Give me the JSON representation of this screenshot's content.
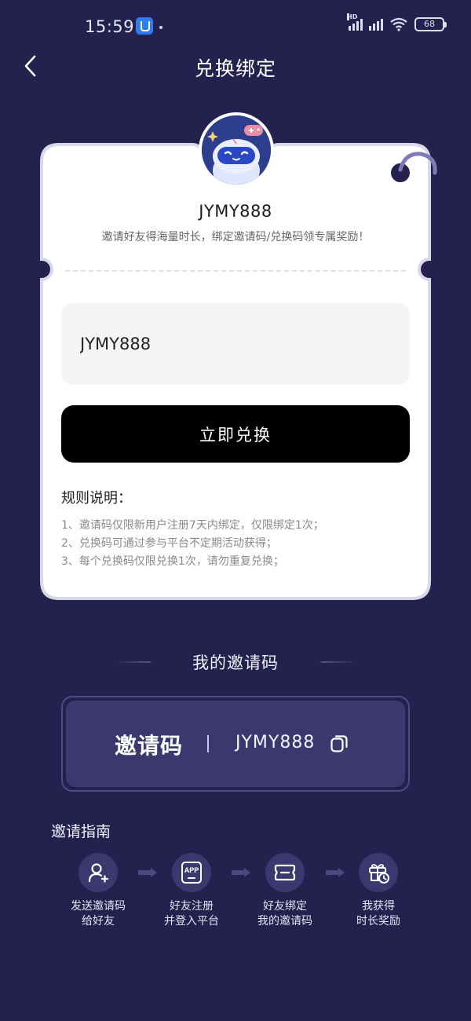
{
  "status_bar": {
    "time": "15:59",
    "battery": "68",
    "network_badge": "HD"
  },
  "header": {
    "title": "兑换绑定"
  },
  "card": {
    "username": "JYMY888",
    "subtitle": "邀请好友得海量时长，绑定邀请码/兑换码领专属奖励！",
    "code_input_value": "JYMY888",
    "redeem_button_label": "立即兑换",
    "rules_title": "规则说明：",
    "rules": [
      "1、邀请码仅限新用户注册7天内绑定，仅限绑定1次；",
      "2、兑换码可通过参与平台不定期活动获得；",
      "3、每个兑换码仅限兑换1次，请勿重复兑换；"
    ]
  },
  "my_invite": {
    "section_title": "我的邀请码",
    "label": "邀请码",
    "code": "JYMY888"
  },
  "guide": {
    "title": "邀请指南",
    "steps": [
      {
        "line1": "发送邀请码",
        "line2": "给好友",
        "icon": "user-add-icon"
      },
      {
        "line1": "好友注册",
        "line2": "并登入平台",
        "icon": "app-icon"
      },
      {
        "line1": "好友绑定",
        "line2": "我的邀请码",
        "icon": "ticket-icon"
      },
      {
        "line1": "我获得",
        "line2": "时长奖励",
        "icon": "gift-clock-icon"
      }
    ],
    "app_icon_text": "APP"
  },
  "colors": {
    "background": "#24214f",
    "card": "#ffffff",
    "button": "#000000",
    "invite_panel": "#3b3870"
  }
}
